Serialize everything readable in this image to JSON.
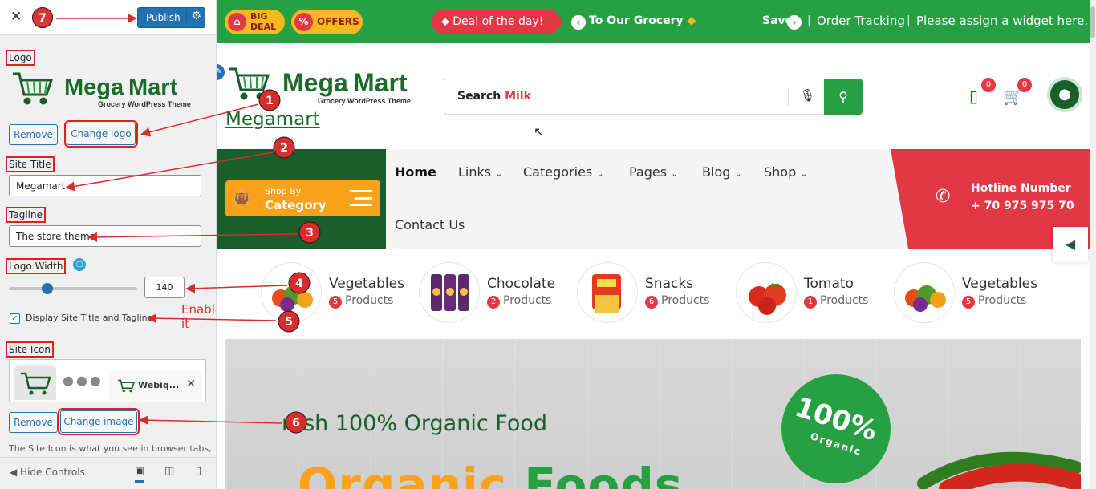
{
  "customizer": {
    "close_label": "✕",
    "publish_label": "Publish",
    "sections": {
      "logo": "Logo",
      "site_title": "Site Title",
      "tagline": "Tagline",
      "logo_width": "Logo Width",
      "site_icon": "Site Icon"
    },
    "logo_remove": "Remove",
    "logo_change": "Change logo",
    "site_title_value": "Megamart",
    "tagline_value": "The store theme",
    "logo_width_value": "140",
    "logo_width_level": 0.3,
    "display_title_tagline_label": "Display Site Title and Tagline",
    "display_title_tagline_checked": true,
    "site_icon_tab_title": "Webiq...",
    "site_icon_remove": "Remove",
    "site_icon_change": "Change image",
    "site_icon_description": "The Site Icon is what you see in browser tabs,",
    "hide_controls": "Hide Controls"
  },
  "annotations": {
    "badges": [
      "1",
      "2",
      "3",
      "4",
      "5",
      "6",
      "7"
    ],
    "enable_note": "Enable it",
    "color": "#d62e2e"
  },
  "logo": {
    "brand_first": "Mega",
    "brand_second": "Mart",
    "subtitle": "Grocery WordPress Theme"
  },
  "topbar": {
    "big_deal": "BIG DEAL",
    "big_deal_line1": "BIG",
    "big_deal_line2": "DEAL",
    "offers": "OFFERS",
    "deal_of_day": "Deal of the day!",
    "marquee": "To Our Grocery",
    "save": "Save",
    "order_tracking": "Order Tracking",
    "widget_link": "Please assign a widget here."
  },
  "header": {
    "site_title": "Megamart",
    "search_placeholder_prefix": "Search",
    "search_placeholder_term": "Milk",
    "wishlist_count": "0",
    "cart_count": "0"
  },
  "nav": {
    "shop_by": "Shop By",
    "category": "Category",
    "items": [
      "Home",
      "Links",
      "Categories",
      "Pages",
      "Blog",
      "Shop"
    ],
    "contact": "Contact Us",
    "hotline_label": "Hotline Number",
    "hotline_number": "+ 70 975 975 70"
  },
  "categories": [
    {
      "name": "Vegetables",
      "count": "5",
      "unit": "Products"
    },
    {
      "name": "Chocolate",
      "count": "2",
      "unit": "Products"
    },
    {
      "name": "Snacks",
      "count": "6",
      "unit": "Products"
    },
    {
      "name": "Tomato",
      "count": "1",
      "unit": "Products"
    },
    {
      "name": "Vegetables",
      "count": "5",
      "unit": "Products"
    }
  ],
  "hero": {
    "tagline": "resh 100% Organic Food",
    "headline_first": "Organic",
    "headline_second": "Foods",
    "seal_percent": "100%",
    "seal_word": "Organic"
  },
  "colors": {
    "brand_green": "#26a043",
    "dark_green": "#1b5e2d",
    "accent_orange": "#f8a21b",
    "accent_red": "#e23744",
    "wp_blue": "#2271b1"
  }
}
